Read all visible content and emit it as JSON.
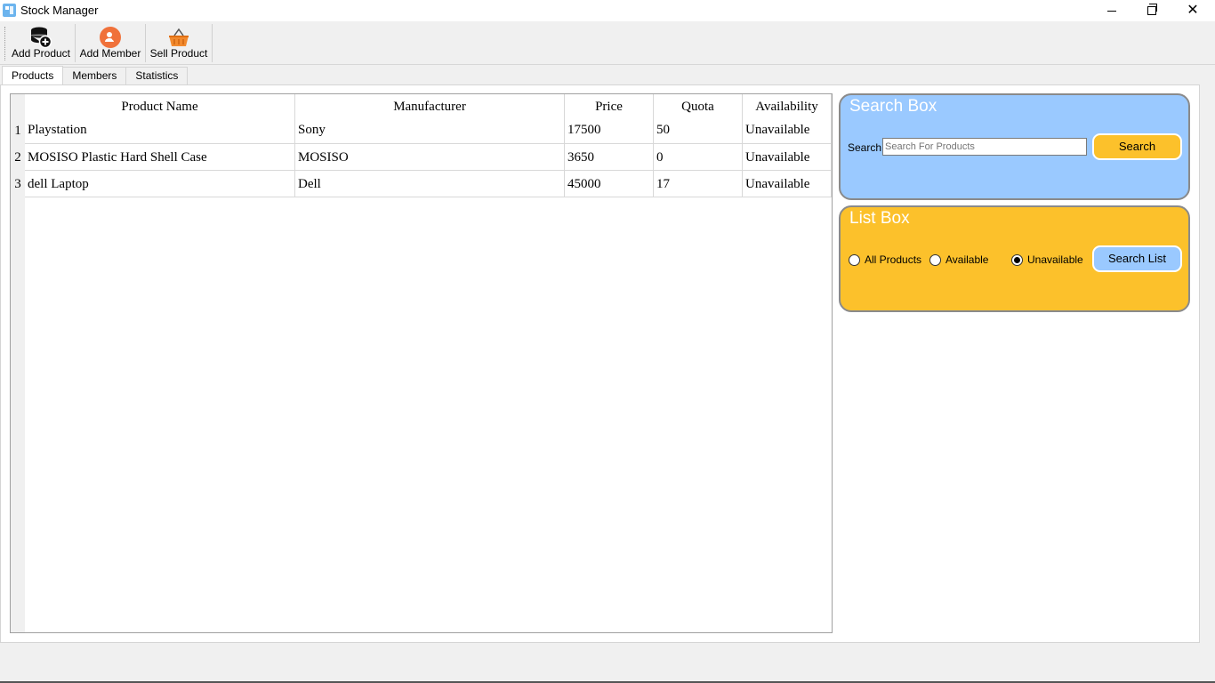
{
  "window": {
    "title": "Stock Manager"
  },
  "toolbar": {
    "add_product": "Add Product",
    "add_member": "Add Member",
    "sell_product": "Sell Product"
  },
  "tabs": [
    {
      "label": "Products",
      "active": true
    },
    {
      "label": "Members",
      "active": false
    },
    {
      "label": "Statistics",
      "active": false
    }
  ],
  "table": {
    "headers": [
      "Product Name",
      "Manufacturer",
      "Price",
      "Quota",
      "Availability"
    ],
    "rows": [
      {
        "num": "1",
        "cells": [
          "Playstation",
          "Sony",
          "17500",
          "50",
          "Unavailable"
        ]
      },
      {
        "num": "2",
        "cells": [
          "MOSISO Plastic Hard Shell Case",
          "MOSISO",
          "3650",
          "0",
          "Unavailable"
        ]
      },
      {
        "num": "3",
        "cells": [
          "dell Laptop",
          "Dell",
          "45000",
          "17",
          "Unavailable"
        ]
      }
    ]
  },
  "search_box": {
    "title": "Search Box",
    "label": "Search",
    "placeholder": "Search For Products",
    "button": "Search",
    "color": "#9ac9ff"
  },
  "list_box": {
    "title": "List Box",
    "options": [
      "All Products",
      "Available",
      "Unavailable"
    ],
    "selected": "Unavailable",
    "button": "Search List",
    "color": "#fcc12b"
  }
}
